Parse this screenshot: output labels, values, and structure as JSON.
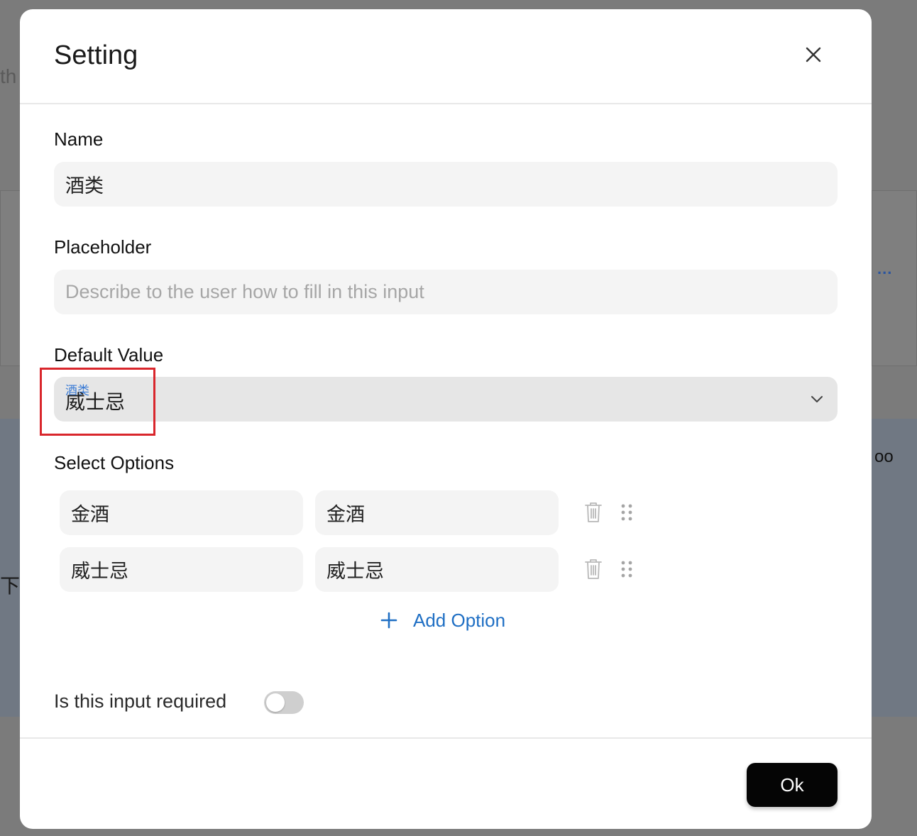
{
  "background": {
    "fragment_left_top": "th",
    "fragment_left_mid": "下",
    "fragment_right": "oo",
    "dots": "..."
  },
  "modal": {
    "title": "Setting",
    "name": {
      "label": "Name",
      "value": "酒类"
    },
    "placeholder": {
      "label": "Placeholder",
      "value": "",
      "hint": "Describe to the user how to fill in this input"
    },
    "default_value": {
      "label": "Default Value",
      "group_tag": "酒类",
      "selected": "威士忌"
    },
    "select_options": {
      "label": "Select Options",
      "options": [
        {
          "label": "金酒",
          "value": "金酒"
        },
        {
          "label": "威士忌",
          "value": "威士忌"
        }
      ],
      "add_label": "Add Option"
    },
    "required": {
      "label": "Is this input required",
      "enabled": false
    },
    "ok_label": "Ok"
  },
  "colors": {
    "accent": "#1f6fc4",
    "highlight": "#d9262c",
    "ok_button": "#050505"
  },
  "icons": [
    "close-icon",
    "chevron-down-icon",
    "trash-icon",
    "drag-handle-icon",
    "plus-icon"
  ]
}
